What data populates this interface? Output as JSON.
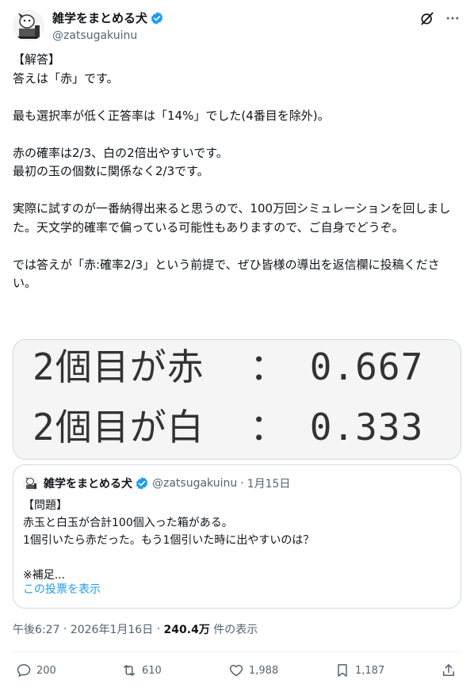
{
  "author": {
    "display_name": "雑学をまとめる犬",
    "handle": "@zatsugakuinu",
    "avatar_icon": "dog-avatar-icon"
  },
  "tweet": {
    "text": "【解答】\n答えは「赤」です。\n\n最も選択率が低く正答率は「14%」でした(4番目を除外)。\n\n赤の確率は2/3、白の2倍出やすいです。\n最初の玉の個数に関係なく2/3です。\n\n実際に試すのが一番納得出来ると思うので、100万回シミュレーションを回しました。天文学的確率で偏っている可能性もありますので、ご自身でどうぞ。\n\nでは答えが「赤:確率2/3」という前提で、ぜひ皆様の導出を返信欄に投稿ください。"
  },
  "image": {
    "rows": [
      {
        "label": "2個目が赤",
        "sep": "：",
        "value": "0.667"
      },
      {
        "label": "2個目が白",
        "sep": "：",
        "value": "0.333"
      }
    ]
  },
  "quote": {
    "display_name": "雑学をまとめる犬",
    "handle": "@zatsugakuinu",
    "date": "1月15日",
    "text": "【問題】\n赤玉と白玉が合計100個入った箱がある。\n1個引いたら赤だった。もう1個引いた時に出やすいのは？\n\n※補足...",
    "show_poll": "この投票を表示"
  },
  "meta": {
    "time": "午後6:27",
    "date": "2026年1月16日",
    "views": "240.4万",
    "views_label": "件の表示"
  },
  "actions": {
    "replies": "200",
    "reposts": "610",
    "likes": "1,988",
    "bookmarks": "1,187"
  },
  "colors": {
    "verified": "#1d9bf0",
    "link": "#1d9bf0",
    "secondary_text": "#536471"
  }
}
